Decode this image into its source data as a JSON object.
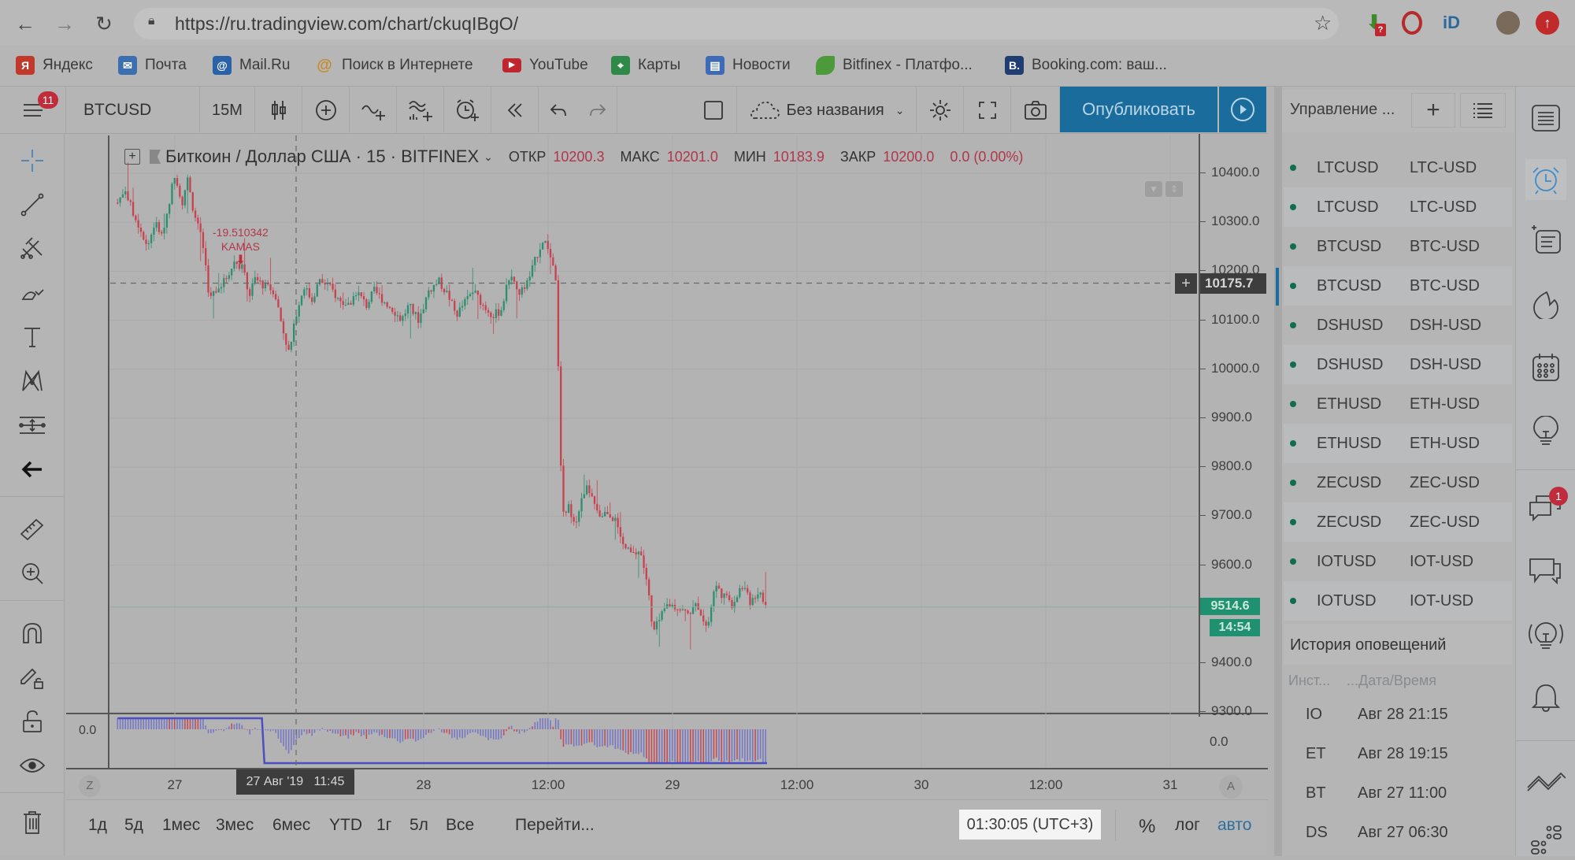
{
  "browser": {
    "url": "https://ru.tradingview.com/chart/ckuqIBgO/",
    "bookmarks": [
      {
        "label": "Яндекс",
        "icon": "yandex-icon",
        "color": "#c0392b"
      },
      {
        "label": "Почта",
        "icon": "mail-icon",
        "color": "#3b6fb0"
      },
      {
        "label": "Mail.Ru",
        "icon": "mailru-icon",
        "color": "#2a62a8"
      },
      {
        "label": "Поиск в Интернете",
        "icon": "search-at-icon",
        "color": "#c78a2a"
      },
      {
        "label": "YouTube",
        "icon": "youtube-icon",
        "color": "#c0262d"
      },
      {
        "label": "Карты",
        "icon": "maps-icon",
        "color": "#2f8a4a"
      },
      {
        "label": "Новости",
        "icon": "news-icon",
        "color": "#3d6bb5"
      },
      {
        "label": "Bitfinex - Платфо...",
        "icon": "bitfinex-icon",
        "color": "#4d9a3a"
      },
      {
        "label": "Booking.com: ваш...",
        "icon": "booking-icon",
        "color": "#1f3d73"
      }
    ],
    "extensions": [
      {
        "name": "download-ext-icon",
        "color": "#3d8a2c",
        "badge": "?"
      },
      {
        "name": "opera-ext-icon",
        "color": "#b52a2a"
      },
      {
        "name": "id-ext-icon",
        "color": "#2a6a9a",
        "text": "iD"
      },
      {
        "name": "profile-avatar",
        "color": "#7a6a5a"
      },
      {
        "name": "update-ext-icon",
        "color": "#c02a2a"
      }
    ]
  },
  "toolbar": {
    "menu_badge": "11",
    "symbol": "BTCUSD",
    "interval": "15M",
    "layout_name": "Без названия",
    "publish_label": "Опубликовать"
  },
  "legend": {
    "title": "Биткоин / Доллар США · 15 · BITFINEX",
    "open_label": "ОТКР",
    "open": "10200.3",
    "high_label": "МАКС",
    "high": "10201.0",
    "low_label": "МИН",
    "low": "10183.9",
    "close_label": "ЗАКР",
    "close": "10200.0",
    "change": "0.0 (0.00%)"
  },
  "annotation": {
    "value": "-19.510342",
    "label": "KAMAS"
  },
  "crosshair": {
    "price": "10175.7",
    "time": "27 Авг '19   11:45"
  },
  "last_price": {
    "price": "9514.6",
    "countdown": "14:54"
  },
  "chart_data": {
    "type": "candlestick",
    "title": "Биткоин / Доллар США · 15 · BITFINEX",
    "interval_minutes": 15,
    "y_ticks": [
      "10400.0",
      "10300.0",
      "10200.0",
      "10100.0",
      "10000.0",
      "9900.0",
      "9800.0",
      "9700.0",
      "9600.0",
      "9400.0",
      "9300.0"
    ],
    "ylim": [
      9290,
      10460
    ],
    "x_ticks": [
      {
        "label": "27",
        "day": 1.0
      },
      {
        "label": "28",
        "day": 2.0
      },
      {
        "label": "12:00",
        "day": 2.5
      },
      {
        "label": "29",
        "day": 3.0
      },
      {
        "label": "12:00",
        "day": 3.5
      },
      {
        "label": "30",
        "day": 4.0
      },
      {
        "label": "12:00",
        "day": 4.5
      },
      {
        "label": "31",
        "day": 5.0
      }
    ],
    "xlim_days": [
      0.74,
      5.25
    ],
    "close_path": [
      [
        0.77,
        10340
      ],
      [
        0.8,
        10370
      ],
      [
        0.83,
        10320
      ],
      [
        0.86,
        10290
      ],
      [
        0.89,
        10250
      ],
      [
        0.92,
        10300
      ],
      [
        0.95,
        10270
      ],
      [
        0.98,
        10350
      ],
      [
        1.0,
        10400
      ],
      [
        1.03,
        10340
      ],
      [
        1.05,
        10390
      ],
      [
        1.08,
        10310
      ],
      [
        1.1,
        10290
      ],
      [
        1.12,
        10230
      ],
      [
        1.14,
        10140
      ],
      [
        1.16,
        10160
      ],
      [
        1.2,
        10180
      ],
      [
        1.24,
        10220
      ],
      [
        1.27,
        10210
      ],
      [
        1.3,
        10150
      ],
      [
        1.32,
        10185
      ],
      [
        1.36,
        10170
      ],
      [
        1.4,
        10160
      ],
      [
        1.43,
        10090
      ],
      [
        1.46,
        10030
      ],
      [
        1.49,
        10120
      ],
      [
        1.52,
        10170
      ],
      [
        1.55,
        10140
      ],
      [
        1.58,
        10180
      ],
      [
        1.62,
        10170
      ],
      [
        1.66,
        10140
      ],
      [
        1.7,
        10130
      ],
      [
        1.73,
        10160
      ],
      [
        1.77,
        10130
      ],
      [
        1.8,
        10160
      ],
      [
        1.84,
        10140
      ],
      [
        1.88,
        10120
      ],
      [
        1.91,
        10100
      ],
      [
        1.94,
        10130
      ],
      [
        1.98,
        10100
      ],
      [
        2.02,
        10160
      ],
      [
        2.06,
        10180
      ],
      [
        2.1,
        10150
      ],
      [
        2.13,
        10110
      ],
      [
        2.17,
        10140
      ],
      [
        2.2,
        10160
      ],
      [
        2.24,
        10130
      ],
      [
        2.28,
        10110
      ],
      [
        2.31,
        10120
      ],
      [
        2.35,
        10200
      ],
      [
        2.38,
        10150
      ],
      [
        2.42,
        10180
      ],
      [
        2.46,
        10240
      ],
      [
        2.48,
        10265
      ],
      [
        2.5,
        10250
      ],
      [
        2.53,
        10180
      ],
      [
        2.54,
        10030
      ],
      [
        2.55,
        9810
      ],
      [
        2.56,
        9700
      ],
      [
        2.58,
        9720
      ],
      [
        2.61,
        9690
      ],
      [
        2.64,
        9740
      ],
      [
        2.66,
        9760
      ],
      [
        2.7,
        9700
      ],
      [
        2.74,
        9710
      ],
      [
        2.77,
        9690
      ],
      [
        2.8,
        9640
      ],
      [
        2.84,
        9620
      ],
      [
        2.87,
        9630
      ],
      [
        2.9,
        9560
      ],
      [
        2.92,
        9460
      ],
      [
        2.95,
        9490
      ],
      [
        2.98,
        9520
      ],
      [
        3.02,
        9515
      ],
      [
        3.06,
        9500
      ],
      [
        3.1,
        9520
      ],
      [
        3.14,
        9470
      ],
      [
        3.17,
        9560
      ],
      [
        3.2,
        9540
      ],
      [
        3.24,
        9520
      ],
      [
        3.28,
        9560
      ],
      [
        3.31,
        9525
      ],
      [
        3.35,
        9550
      ],
      [
        3.38,
        9510
      ]
    ],
    "oscillator": {
      "zero_label": "0.0",
      "right_label": "0.0",
      "step_line": [
        [
          0.77,
          0.6
        ],
        [
          1.35,
          0.6
        ],
        [
          1.36,
          -1.0
        ],
        [
          3.38,
          -1.0
        ]
      ]
    }
  },
  "time_axis_buttons": {
    "left": "Z",
    "right": "A"
  },
  "ranges": [
    "1д",
    "5д",
    "1мес",
    "3мес",
    "6мес",
    "YTD",
    "1г",
    "5л",
    "Все"
  ],
  "goto_label": "Перейти...",
  "clock": "01:30:05 (UTC+3)",
  "scale_opts": {
    "percent": "%",
    "log": "лог",
    "auto": "авто"
  },
  "watchlist": {
    "title": "Управление ...",
    "rows": [
      {
        "symbol": "LTCUSD",
        "desc": "LTC-USD"
      },
      {
        "symbol": "LTCUSD",
        "desc": "LTC-USD"
      },
      {
        "symbol": "BTCUSD",
        "desc": "BTC-USD"
      },
      {
        "symbol": "BTCUSD",
        "desc": "BTC-USD"
      },
      {
        "symbol": "DSHUSD",
        "desc": "DSH-USD"
      },
      {
        "symbol": "DSHUSD",
        "desc": "DSH-USD"
      },
      {
        "symbol": "ETHUSD",
        "desc": "ETH-USD"
      },
      {
        "symbol": "ETHUSD",
        "desc": "ETH-USD"
      },
      {
        "symbol": "ZECUSD",
        "desc": "ZEC-USD"
      },
      {
        "symbol": "ZECUSD",
        "desc": "ZEC-USD"
      },
      {
        "symbol": "IOTUSD",
        "desc": "IOT-USD"
      },
      {
        "symbol": "IOTUSD",
        "desc": "IOT-USD"
      }
    ]
  },
  "alert_history": {
    "title": "История оповещений",
    "col_instrument": "Инст...",
    "col_datetime": "...Дата/Время",
    "rows": [
      {
        "inst": "IO",
        "time": "Авг 28 21:15"
      },
      {
        "inst": "ET",
        "time": "Авг 28 19:15"
      },
      {
        "inst": "BT",
        "time": "Авг 27 11:00"
      },
      {
        "inst": "DS",
        "time": "Авг 27 06:30"
      }
    ]
  },
  "right_sidebar": {
    "chat_badge": "1"
  },
  "colors": {
    "up": "#2d8f6f",
    "down": "#c8414f",
    "accent": "#1a6c9c",
    "osc_line": "#4b4fc2",
    "osc_bar": "#7072c8"
  }
}
